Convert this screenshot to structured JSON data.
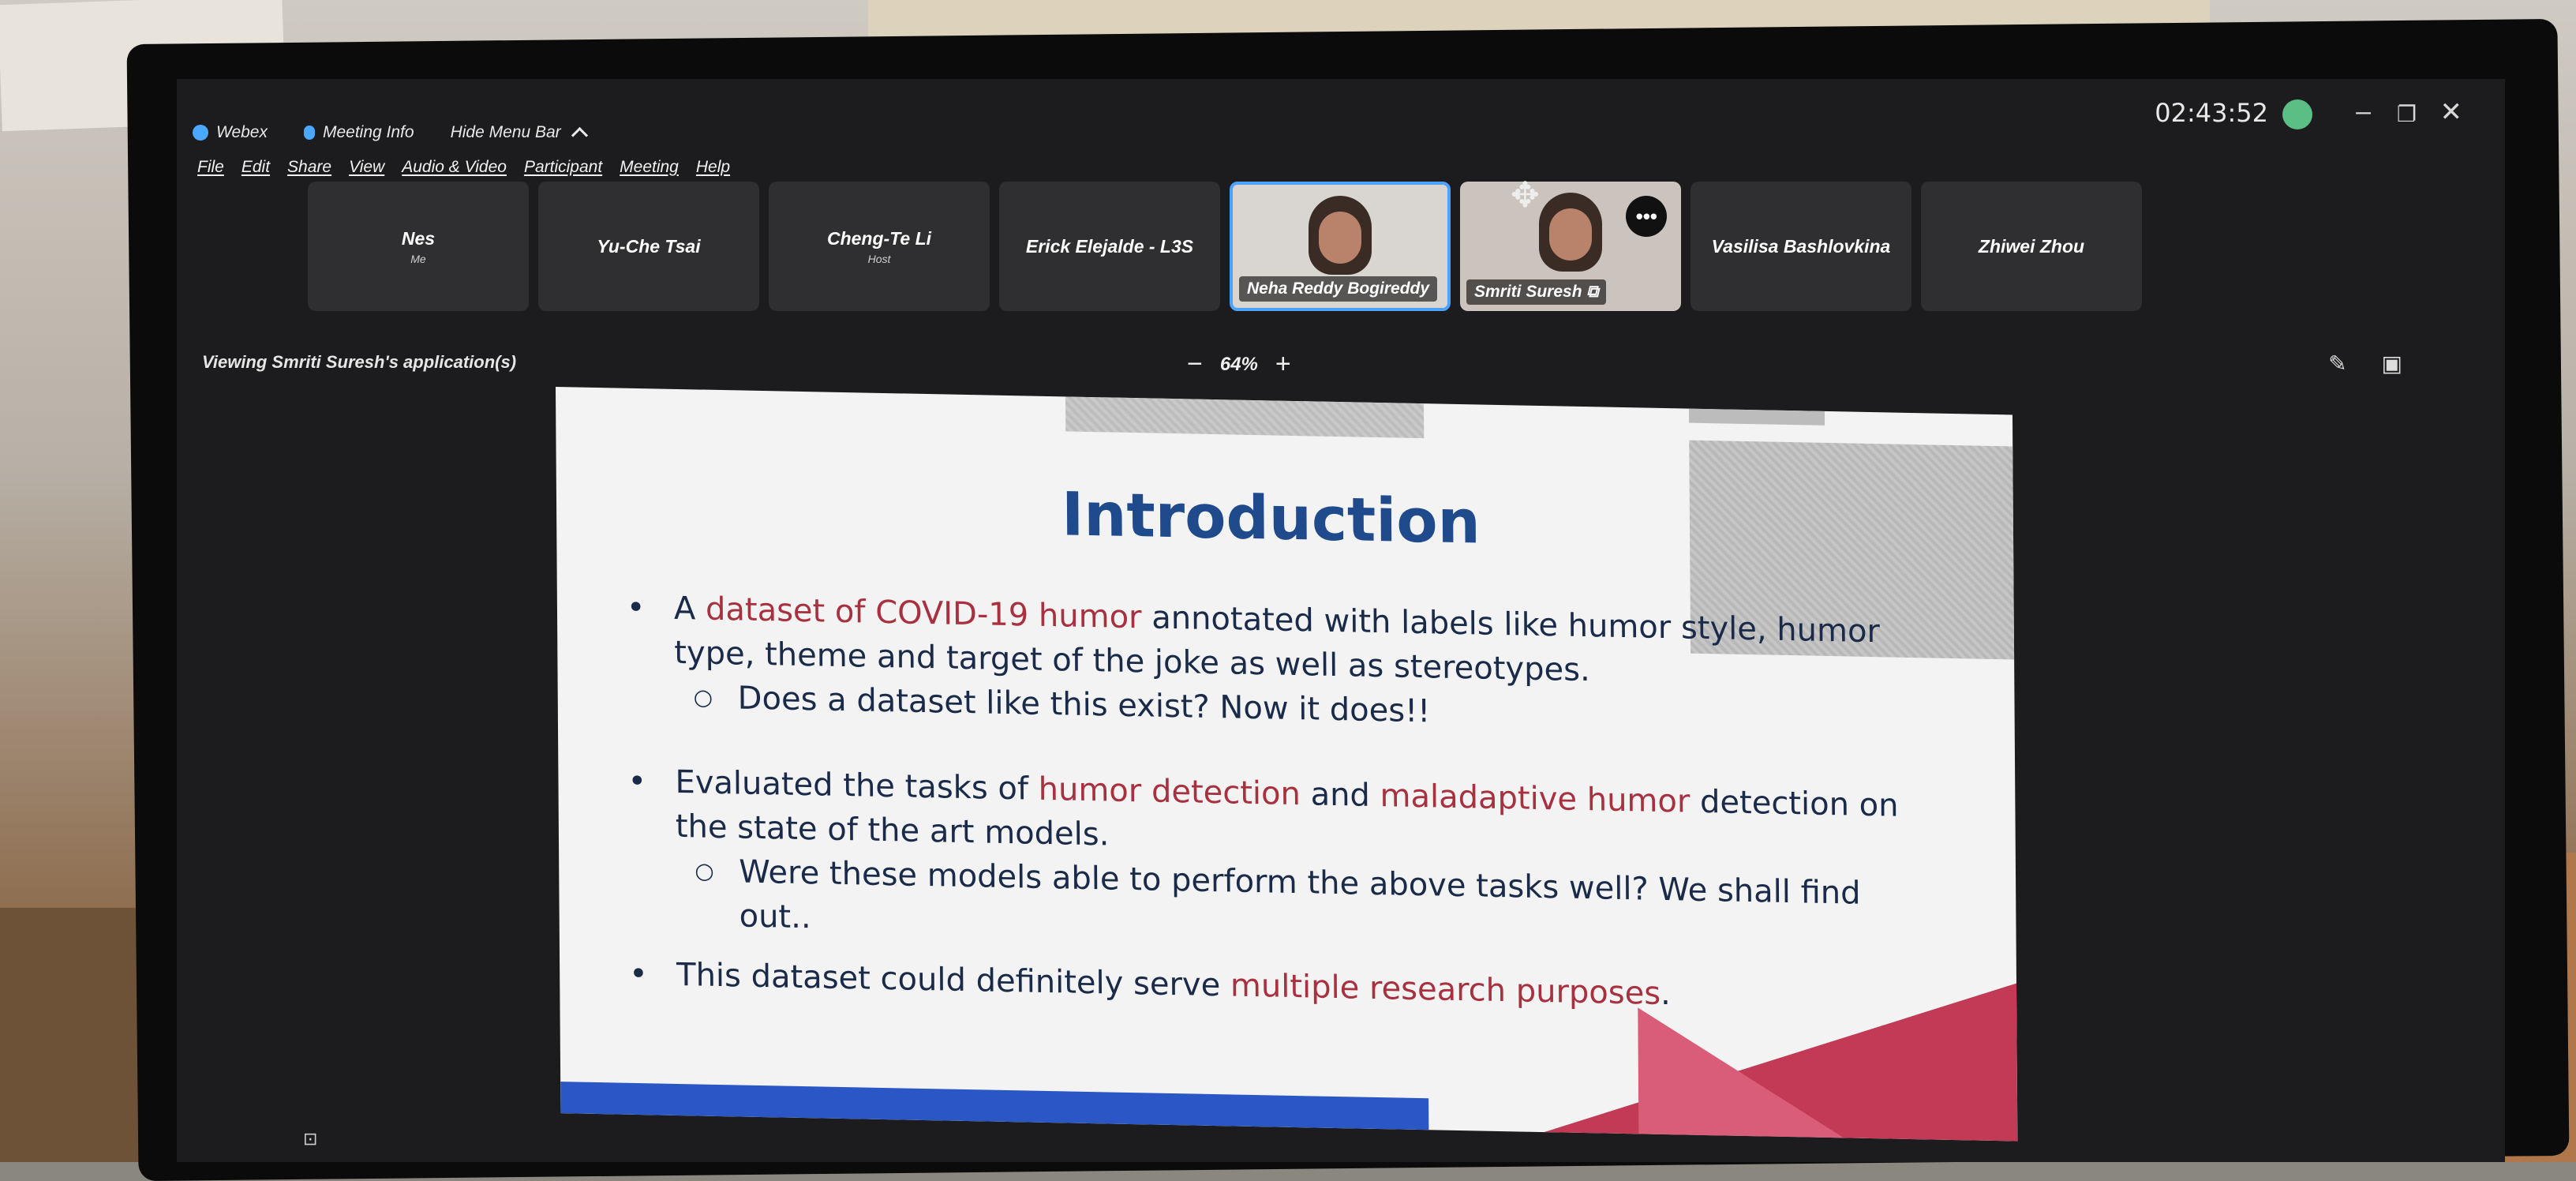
{
  "app": {
    "name": "Webex",
    "meeting_info": "Meeting Info",
    "hide_menu_bar": "Hide Menu Bar",
    "clock": "02:43:52"
  },
  "menu": [
    "File",
    "Edit",
    "Share",
    "View",
    "Audio & Video",
    "Participant",
    "Meeting",
    "Help"
  ],
  "participants": [
    {
      "name": "Nes",
      "sub": "Me"
    },
    {
      "name": "Yu-Che Tsai",
      "sub": ""
    },
    {
      "name": "Cheng-Te Li",
      "sub": "Host"
    },
    {
      "name": "Erick Elejalde - L3S",
      "sub": ""
    },
    {
      "name": "Neha Reddy Bogireddy",
      "sub": ""
    },
    {
      "name": "Smriti Suresh",
      "sub": ""
    },
    {
      "name": "Vasilisa Bashlovkina",
      "sub": ""
    },
    {
      "name": "Zhiwei Zhou",
      "sub": ""
    }
  ],
  "viewing": "Viewing Smriti Suresh's application(s)",
  "zoom": {
    "level": "64%",
    "minus": "−",
    "plus": "+"
  },
  "slide": {
    "title": "Introduction",
    "b1_pre": "A ",
    "b1_hl": "dataset of COVID-19 humor",
    "b1_post": " annotated with labels like humor style, humor type, theme and target of the joke as well as stereotypes.",
    "s1": "Does a dataset like this exist? Now it does!!",
    "b2_pre": "Evaluated the tasks of ",
    "b2_hl1": "humor detection",
    "b2_mid": " and ",
    "b2_hl2": "maladaptive humor",
    "b2_post": " detection on the state of the art models.",
    "s2": "Were these models able to perform the above tasks well? We shall find out..",
    "b3_pre": "This dataset could definitely serve ",
    "b3_hl": "multiple research purposes",
    "b3_post": "."
  }
}
